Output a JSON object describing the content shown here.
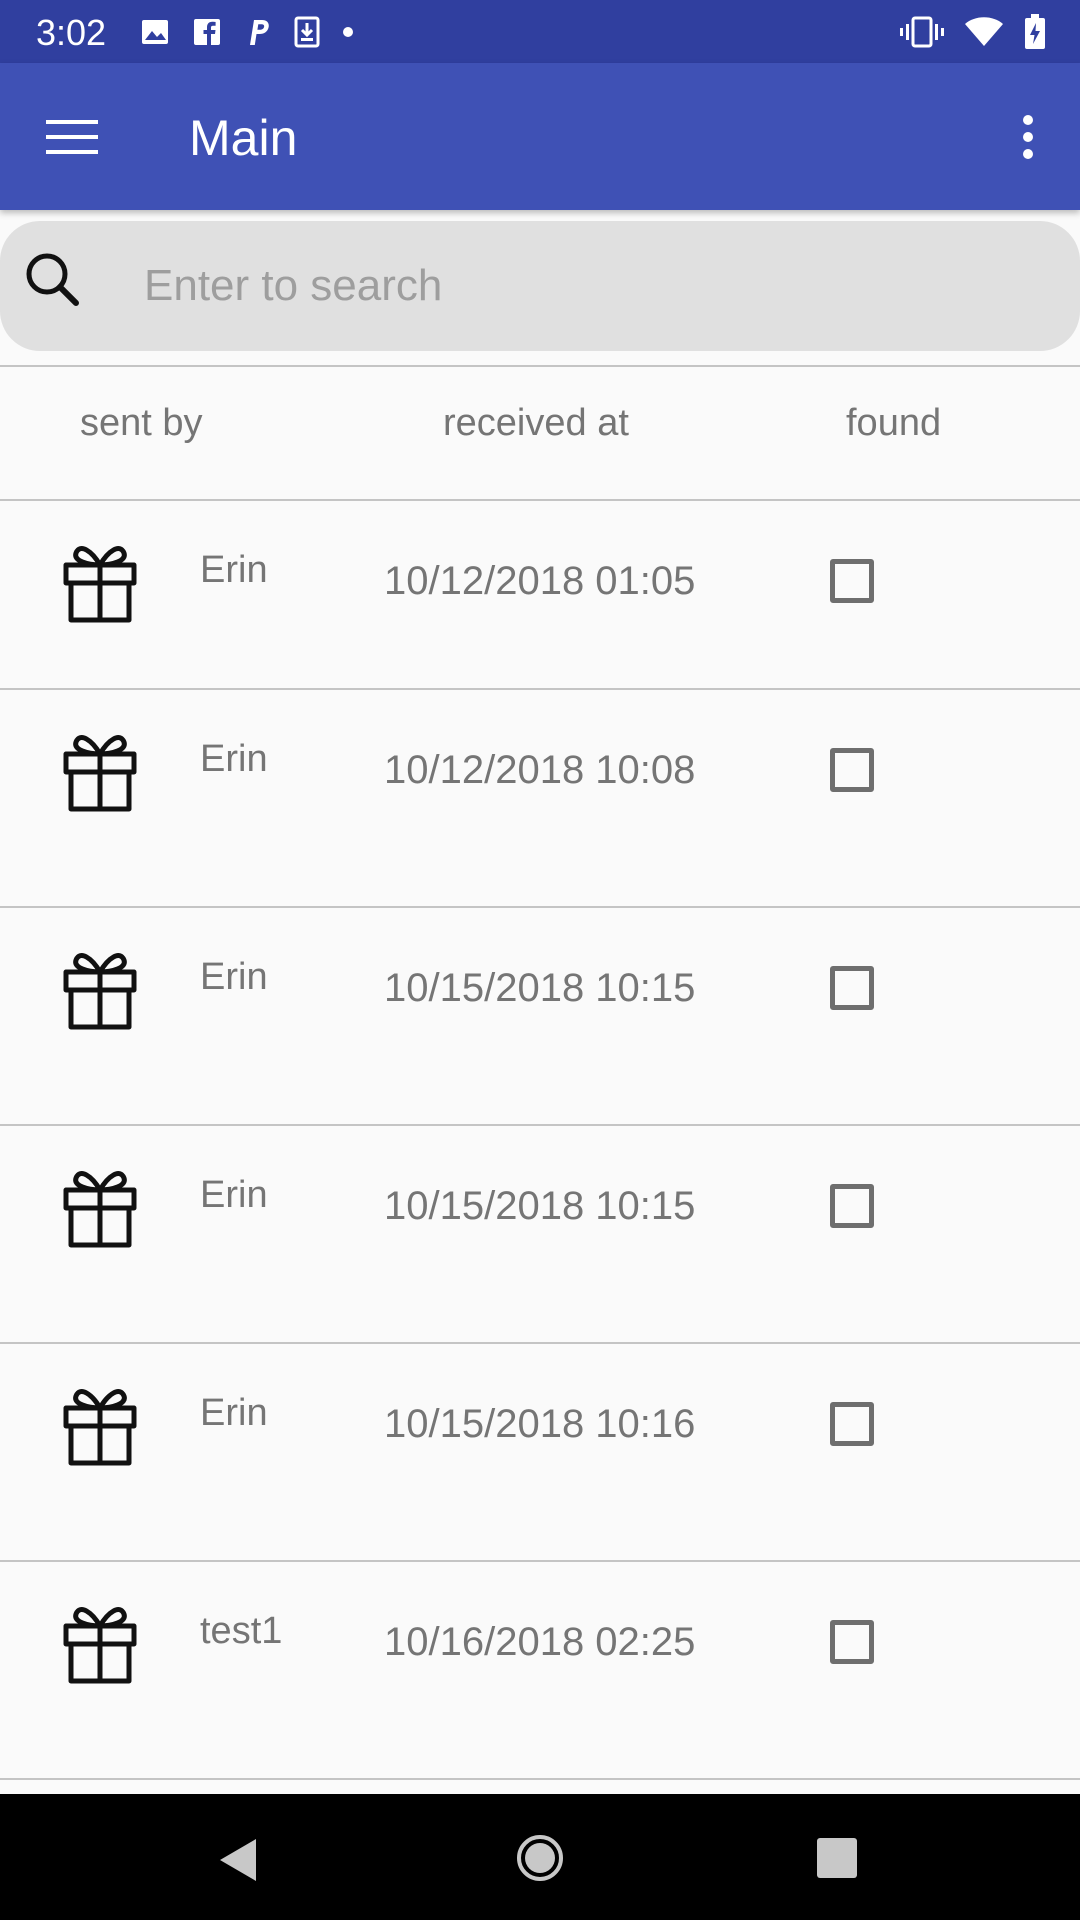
{
  "status_bar": {
    "time": "3:02",
    "left_icons": [
      "image-icon",
      "facebook-icon",
      "paypal-icon",
      "download-icon",
      "dot-icon"
    ],
    "right_icons": [
      "vibrate-icon",
      "wifi-icon",
      "battery-icon"
    ]
  },
  "app_bar": {
    "title": "Main",
    "background": "#3f51b5",
    "status_background": "#303f9f"
  },
  "search": {
    "placeholder": "Enter to search",
    "value": ""
  },
  "table": {
    "headers": {
      "sender": "sent by",
      "received": "received at",
      "found": "found"
    },
    "rows": [
      {
        "sender": "Erin",
        "received": "10/12/2018 01:05",
        "found": false
      },
      {
        "sender": "Erin",
        "received": "10/12/2018 10:08",
        "found": false
      },
      {
        "sender": "Erin",
        "received": "10/15/2018 10:15",
        "found": false
      },
      {
        "sender": "Erin",
        "received": "10/15/2018 10:15",
        "found": false
      },
      {
        "sender": "Erin",
        "received": "10/15/2018 10:16",
        "found": false
      },
      {
        "sender": "test1",
        "received": "10/16/2018 02:25",
        "found": false
      }
    ]
  },
  "nav_bar": {
    "buttons": [
      "back-icon",
      "home-icon",
      "recents-icon"
    ]
  }
}
